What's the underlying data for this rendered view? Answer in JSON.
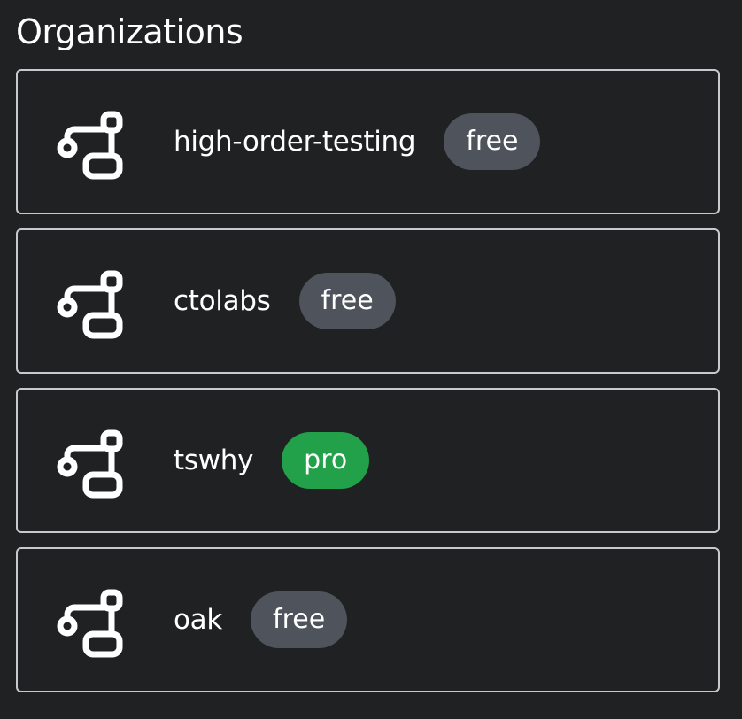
{
  "header": {
    "title": "Organizations"
  },
  "icons": {
    "org_icon": "git-branch-icon"
  },
  "colors": {
    "background": "#1f2123",
    "card_border": "#c7c9cc",
    "badge_free": "#4f535b",
    "badge_pro": "#22a04a",
    "text": "#ffffff"
  },
  "organizations": [
    {
      "name": "high-order-testing",
      "plan": "free"
    },
    {
      "name": "ctolabs",
      "plan": "free"
    },
    {
      "name": "tswhy",
      "plan": "pro"
    },
    {
      "name": "oak",
      "plan": "free"
    }
  ]
}
